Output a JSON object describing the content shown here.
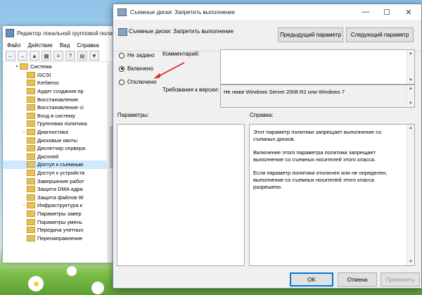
{
  "background_window": {
    "title": "Редактор локальной групповой поли",
    "menu": [
      "Файл",
      "Действие",
      "Вид",
      "Справка"
    ],
    "tree": [
      {
        "label": "Система",
        "expanded": true,
        "indent": 0,
        "arrow": "v"
      },
      {
        "label": "iSCSI",
        "indent": 1,
        "arrow": ""
      },
      {
        "label": "Kerberos",
        "indent": 1,
        "arrow": ""
      },
      {
        "label": "Аудит создания пр",
        "indent": 1,
        "arrow": ""
      },
      {
        "label": "Восстановление",
        "indent": 1,
        "arrow": ""
      },
      {
        "label": "Восстановление сі",
        "indent": 1,
        "arrow": ""
      },
      {
        "label": "Вход в систему",
        "indent": 1,
        "arrow": ""
      },
      {
        "label": "Групповая политика",
        "indent": 1,
        "arrow": ""
      },
      {
        "label": "Диагностика",
        "indent": 1,
        "arrow": ">"
      },
      {
        "label": "Дисковые квоты",
        "indent": 1,
        "arrow": ""
      },
      {
        "label": "Диспетчер сервера",
        "indent": 1,
        "arrow": ""
      },
      {
        "label": "Дисплей",
        "indent": 1,
        "arrow": ""
      },
      {
        "label": "Доступ к съемным",
        "indent": 1,
        "arrow": "",
        "selected": true
      },
      {
        "label": "Доступ к устройств",
        "indent": 1,
        "arrow": ""
      },
      {
        "label": "Завершение работ",
        "indent": 1,
        "arrow": ""
      },
      {
        "label": "Защита DMA адра",
        "indent": 1,
        "arrow": ""
      },
      {
        "label": "Защита файлов W",
        "indent": 1,
        "arrow": ""
      },
      {
        "label": "Инфраструктура к",
        "indent": 1,
        "arrow": ">"
      },
      {
        "label": "Параметры завер",
        "indent": 1,
        "arrow": ""
      },
      {
        "label": "Параметры умень",
        "indent": 1,
        "arrow": ""
      },
      {
        "label": "Передача учетных",
        "indent": 1,
        "arrow": ""
      },
      {
        "label": "Перенаправление",
        "indent": 1,
        "arrow": ""
      }
    ]
  },
  "dialog": {
    "title": "Съемные диски: Запретить выполнение",
    "header_title": "Съемные диски: Запретить выполнение",
    "prev_button": "Предыдущий параметр",
    "next_button": "Следующий параметр",
    "radio_not_configured": "Не задано",
    "radio_enabled": "Включено",
    "radio_disabled": "Отключено",
    "selected_radio": "enabled",
    "comment_label": "Комментарий:",
    "comment_value": "",
    "supported_label": "Требования к версии:",
    "supported_value": "Не ниже Windows Server 2008 R2 или Windows 7",
    "options_label": "Параметры:",
    "help_label": "Справка:",
    "help_paragraphs": [
      "Этот параметр политики запрещает выполнение со съемных дисков.",
      "Включение этого параметра политики запрещает выполнение со съемных носителей этого класса.",
      "Если параметр политики отключен или не определен, выполнение со съемных носителей этого класса разрешено."
    ],
    "ok_button": "OK",
    "cancel_button": "Отмена",
    "apply_button": "Применить"
  },
  "colors": {
    "annotation_arrow": "#e02020",
    "selection": "#cde8ff",
    "default_button_border": "#0078d7"
  }
}
